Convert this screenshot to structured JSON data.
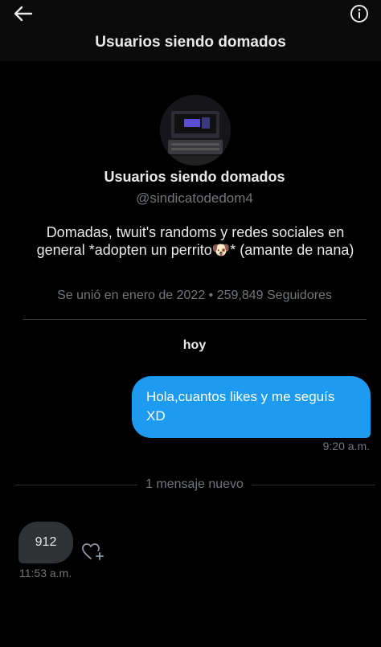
{
  "header": {
    "title": "Usuarios siendo domados",
    "back_icon": "arrow-left-icon",
    "info_icon": "info-circle-icon"
  },
  "profile": {
    "name": "Usuarios siendo domados",
    "handle": "@sindicatodedom4",
    "bio_part1": "Domadas, twuit's randoms y redes sociales en general   *adopten un perrito",
    "bio_emoji": "🐶",
    "bio_part2": "*            (amante de nana)",
    "meta": "Se unió en enero de 2022 • 259,849 Seguidores"
  },
  "conversation": {
    "day_label": "hoy",
    "outgoing_message": "Hola,cuantos likes y me seguís XD",
    "outgoing_time": "9:20 a.m.",
    "new_message_label": "1 mensaje nuevo",
    "incoming_message": "912",
    "incoming_time": "11:53 a.m.",
    "reaction_icon": "heart-plus-icon"
  },
  "colors": {
    "background": "#000000",
    "accent": "#1d9bf0",
    "muted_text": "#71767b",
    "incoming_bubble": "#2f3336"
  }
}
